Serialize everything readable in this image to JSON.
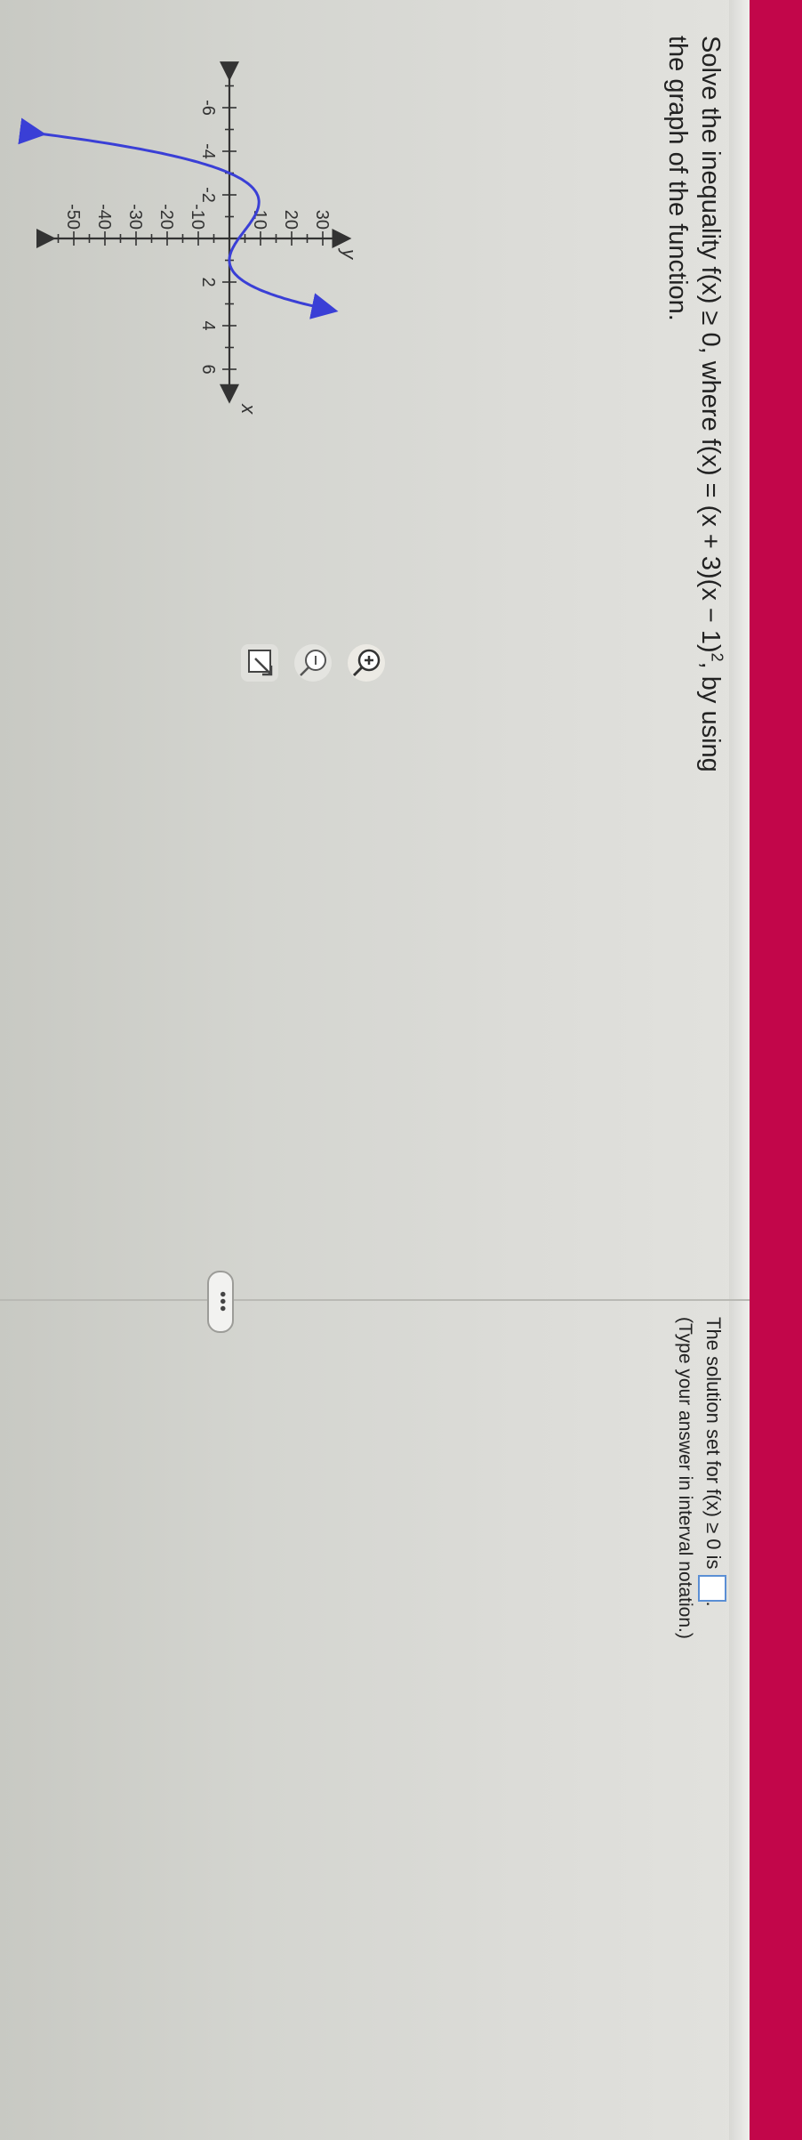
{
  "question": {
    "prefix": "Solve the inequality f(x) ≥ 0, where f(x) = (x + 3)(x − 1)",
    "exponent": "2",
    "suffix": ", by using the graph of the function."
  },
  "graph": {
    "y_axis_label": "y",
    "x_axis_label": "x",
    "x_tick_labels": [
      "-6",
      "-4",
      "-2",
      "2",
      "4",
      "6"
    ],
    "y_tick_labels": [
      "30",
      "20",
      "10",
      "-10",
      "-20",
      "-30",
      "-40",
      "-50"
    ],
    "curve_color": "#3a3fd6",
    "function": "(x + 3)(x - 1)^2"
  },
  "tools": {
    "zoom_in": "zoom-in-icon",
    "zoom_out": "zoom-out-icon",
    "expand": "expand-icon"
  },
  "more_button": "•••",
  "answer": {
    "prompt": "The solution set for f(x) ≥ 0 is",
    "hint": "(Type your answer in interval notation.)"
  },
  "colors": {
    "side_strip": "#c2064a",
    "answer_box_border": "#5b8fd4"
  }
}
